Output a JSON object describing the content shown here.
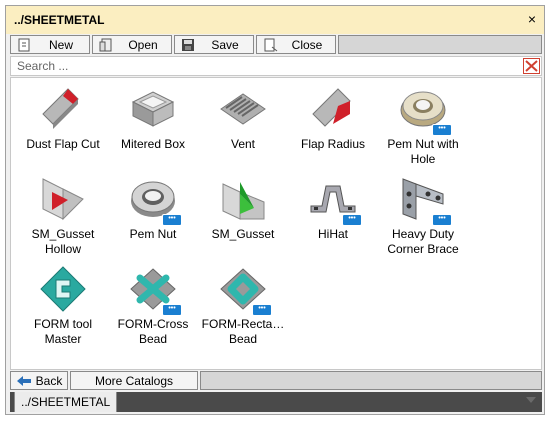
{
  "window": {
    "title": "../SHEETMETAL",
    "close_glyph": "×"
  },
  "toolbar": {
    "new_label": "New",
    "open_label": "Open",
    "save_label": "Save",
    "close_label": "Close"
  },
  "search": {
    "placeholder": "Search ...",
    "value": ""
  },
  "items": [
    {
      "label": "Dust Flap Cut",
      "icon": "dust-flap-cut-icon",
      "has_badge": false
    },
    {
      "label": "Mitered Box",
      "icon": "mitered-box-icon",
      "has_badge": false
    },
    {
      "label": "Vent",
      "icon": "vent-icon",
      "has_badge": false
    },
    {
      "label": "Flap Radius",
      "icon": "flap-radius-icon",
      "has_badge": false
    },
    {
      "label": "Pem Nut with Hole",
      "icon": "pem-nut-with-hole-icon",
      "has_badge": true
    },
    {
      "label": "SM_Gusset Hollow",
      "icon": "gusset-hollow-icon",
      "has_badge": false
    },
    {
      "label": "Pem Nut",
      "icon": "pem-nut-icon",
      "has_badge": true
    },
    {
      "label": "SM_Gusset",
      "icon": "gusset-icon",
      "has_badge": false
    },
    {
      "label": "HiHat",
      "icon": "hihat-icon",
      "has_badge": true
    },
    {
      "label": "Heavy Duty Corner Brace",
      "icon": "corner-brace-icon",
      "has_badge": true
    },
    {
      "label": "FORM tool Master",
      "icon": "form-tool-master-icon",
      "has_badge": false
    },
    {
      "label": "FORM-Cross Bead",
      "icon": "form-cross-bead-icon",
      "has_badge": true
    },
    {
      "label": "FORM-Recta… Bead",
      "icon": "form-rectangle-bead-icon",
      "has_badge": true
    }
  ],
  "badge_text": "•••",
  "bottom": {
    "back_label": "Back",
    "more_label": "More Catalogs"
  },
  "tabs": {
    "active_label": "../SHEETMETAL"
  },
  "colors": {
    "title_bar": "#fbeec1",
    "badge": "#1a7fd1",
    "accent_red": "#d0202a",
    "form_teal": "#2aa9a0"
  }
}
